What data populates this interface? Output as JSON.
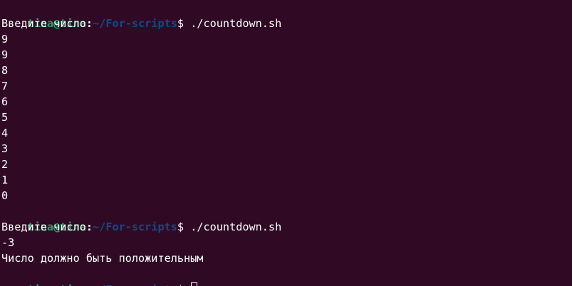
{
  "prompt": {
    "user": "tina@tina",
    "separator": ":",
    "path": "~/For-scripts",
    "symbol": "$"
  },
  "colors": {
    "background": "#300a24",
    "user": "#26a269",
    "path": "#12488b",
    "text": "#ffffff"
  },
  "session": [
    {
      "command": " ./countdown.sh",
      "output": [
        "Введите число:",
        "9",
        "9",
        "8",
        "7",
        "6",
        "5",
        "4",
        "3",
        "2",
        "1",
        "0"
      ]
    },
    {
      "command": " ./countdown.sh",
      "output": [
        "Введите число:",
        "-3",
        "Число должно быть положительным"
      ]
    },
    {
      "command": " ",
      "output": []
    }
  ],
  "cursor_icon": "block-cursor-outline"
}
